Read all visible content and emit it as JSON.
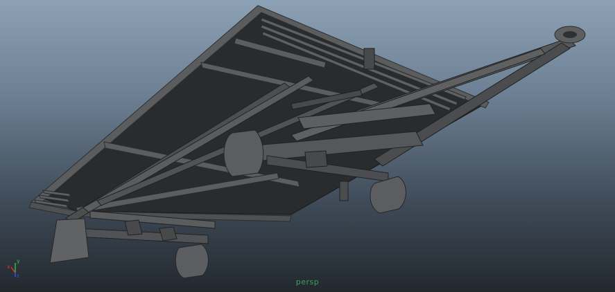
{
  "viewport": {
    "camera_name": "persp",
    "background_top": "#8da1b5",
    "background_bottom": "#23282e"
  },
  "gizmo": {
    "x_label": "x",
    "y_label": "y",
    "z_label": "z",
    "x_color": "#e03030",
    "y_color": "#30c040",
    "z_color": "#3050e0"
  },
  "model": {
    "object": "trailer-chassis",
    "shade_color": "#3d3f41",
    "deck_color": "#2a2b2c"
  }
}
